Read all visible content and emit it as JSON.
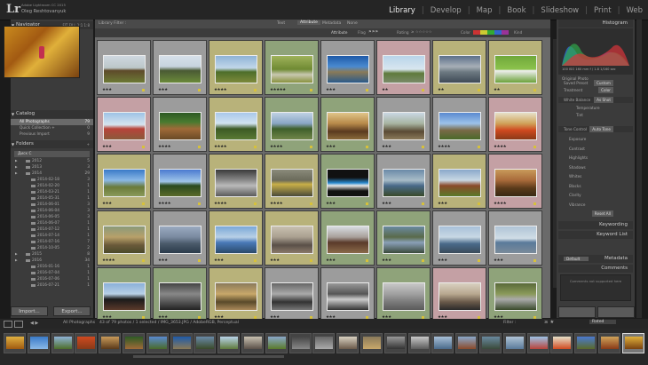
{
  "app": {
    "logo": "Lr",
    "version": "Adobe Lightroom CC 2015",
    "user": "Oleg Reshtovanyuk"
  },
  "modules": [
    "Library",
    "Develop",
    "Map",
    "Book",
    "Slideshow",
    "Print",
    "Web"
  ],
  "active_module": "Library",
  "left_panel": {
    "navigator": {
      "title": "Navigator",
      "options": "FIT  FILL  1:1  1:8"
    },
    "catalog": {
      "title": "Catalog",
      "items": [
        {
          "label": "All Photographs",
          "count": "79"
        },
        {
          "label": "Quick Collection +",
          "count": "0"
        },
        {
          "label": "Previous Import",
          "count": "9"
        }
      ]
    },
    "folders": {
      "title": "Folders",
      "drive": "Диск C"
    },
    "years": [
      {
        "label": "2012",
        "count": "5"
      },
      {
        "label": "2013",
        "count": "3"
      },
      {
        "label": "2014",
        "count": "29"
      }
    ],
    "months_2014": [
      {
        "label": "2014-02-18",
        "count": "3"
      },
      {
        "label": "2014-02-20",
        "count": "1"
      },
      {
        "label": "2014-03-21",
        "count": "1"
      },
      {
        "label": "2014-05-31",
        "count": "1"
      },
      {
        "label": "2014-06-01",
        "count": "3"
      },
      {
        "label": "2014-06-04",
        "count": "3"
      },
      {
        "label": "2014-06-05",
        "count": "3"
      },
      {
        "label": "2014-06-07",
        "count": "1"
      },
      {
        "label": "2014-07-12",
        "count": "1"
      },
      {
        "label": "2014-07-14",
        "count": "1"
      },
      {
        "label": "2014-07-16",
        "count": "7"
      },
      {
        "label": "2014-10-05",
        "count": "2"
      }
    ],
    "years_after": [
      {
        "label": "2015",
        "count": "8"
      },
      {
        "label": "2016",
        "count": "34"
      }
    ],
    "months_2016": [
      {
        "label": "2016-01-16",
        "count": "1"
      },
      {
        "label": "2016-07-04",
        "count": "1"
      },
      {
        "label": "2016-07-06",
        "count": "1"
      },
      {
        "label": "2016-07-21",
        "count": "1"
      }
    ],
    "import_label": "Import...",
    "export_label": "Export..."
  },
  "filter_bar": {
    "title": "Library Filter :",
    "tabs": [
      "Text",
      "Attribute",
      "Metadata",
      "None"
    ],
    "active": "Attribute"
  },
  "toolbar": {
    "attribute": "Attribute",
    "flag": "Flag",
    "rating": "Rating",
    "color": "Color",
    "kind": "Kind"
  },
  "grid": {
    "cells": [
      {
        "rating": "★★★",
        "bg": "#9c9c9c",
        "img": "linear-gradient(#cfd8e0 0%,#bcc7c9 45%,#5e4a2a 55%,#6c7a35 100%)"
      },
      {
        "rating": "★★★",
        "bg": "#9c9c9c",
        "img": "linear-gradient(#d6e0ea 0%,#c7d3de 40%,#4a5a34 55%,#6b8a3a 100%)"
      },
      {
        "rating": "★★★★",
        "bg": "#b8b27a",
        "img": "linear-gradient(#8fb3d6 0%,#c1d7ea 45%,#4d6e2a 60%,#7d8a3b 100%)"
      },
      {
        "rating": "★★★★★",
        "bg": "#8fa37a",
        "img": "linear-gradient(#9fb25a 0%,#6f8a33 50%,#c8c8b0 70%,#88923e 100%)"
      },
      {
        "rating": "★★★",
        "bg": "#9c9c9c",
        "img": "linear-gradient(#1e5aa8 0%,#4a8ad0 40%,#8a7a58 60%,#2a5a8a 100%)"
      },
      {
        "rating": "★★",
        "bg": "#c4a0a4",
        "img": "linear-gradient(#b9d4ea 0%,#d8e6ef 50%,#5f7a3c 65%,#7a8a68 100%)"
      },
      {
        "rating": "★★",
        "bg": "#b8b27a",
        "img": "linear-gradient(#5b6f8a 0%,#a7afb7 40%,#6d7a82 60%,#3f4a56 100%)"
      },
      {
        "rating": "★★",
        "bg": "#b8b27a",
        "img": "linear-gradient(#6fa83a 0%,#8cc24c 50%,#f0f0f0 55%,#6ba23a 100%)"
      },
      {
        "rating": "★★★",
        "bg": "#c4a0a4",
        "img": "linear-gradient(#9ec3e6 0%,#d6e4ef 45%,#b8433a 60%,#8a5a3a 100%)"
      },
      {
        "rating": "★★★★",
        "bg": "#9c9c9c",
        "img": "linear-gradient(#2d5a24 0%,#4a7a30 35%,#a06a38 60%,#6a4a26 100%)"
      },
      {
        "rating": "★★★★",
        "bg": "#b8b27a",
        "img": "linear-gradient(#a9c8ea 0%,#d2e3f0 40%,#3c5a24 60%,#5a7a34 100%)"
      },
      {
        "rating": "★★★★",
        "bg": "#8fa37a",
        "img": "linear-gradient(#bfd1e4 0%,#8aa6c4 40%,#3e5f2a 60%,#71874a 100%)"
      },
      {
        "rating": "★★★",
        "bg": "#8fa37a",
        "img": "linear-gradient(#e0c58a 0%,#b88a4a 40%,#5a3a20 70%,#8a6a3a 100%)"
      },
      {
        "rating": "★★★",
        "bg": "#9c9c9c",
        "img": "linear-gradient(#c9d7e4 0%,#a8b5a2 40%,#5a4a34 70%,#8a7a5a 100%)"
      },
      {
        "rating": "★★★★",
        "bg": "#9c9c9c",
        "img": "linear-gradient(#5a8ad0 0%,#9cc2ea 40%,#7a6a48 65%,#4a6a2a 100%)"
      },
      {
        "rating": "★★★★",
        "bg": "#c4a0a4",
        "img": "linear-gradient(#e6e0c8 0%,#d0a35a 40%,#d04a20 65%,#8a3a18 100%)"
      },
      {
        "rating": "★★★",
        "bg": "#b8b27a",
        "img": "linear-gradient(#3a7ac8 0%,#8ab8e6 40%,#6a7a3a 65%,#8a9a5a 100%)"
      },
      {
        "rating": "★★★★",
        "bg": "#9c9c9c",
        "img": "linear-gradient(#4a7ad0 0%,#a0c6ea 45%,#2a4a1e 60%,#5a6a2a 100%)"
      },
      {
        "rating": "★★★★",
        "bg": "#b8b27a",
        "img": "linear-gradient(#3a3a3a 0%,#8a8a8a 40%,#bababa 60%,#5a5a5a 100%)"
      },
      {
        "rating": "★★★★",
        "bg": "#b8b27a",
        "img": "linear-gradient(#8a8a7a 0%,#6a6a5a 40%,#c9b048 55%,#4a4a3a 100%)"
      },
      {
        "rating": "★★★",
        "bg": "#8fa37a",
        "img": "linear-gradient(#111 0%,#111 30%,#2a8ad0 50%,#e8e8e8 60%,#111 80%)"
      },
      {
        "rating": "★★★",
        "bg": "#9c9c9c",
        "img": "linear-gradient(#6a8aa8 0%,#a8bcc8 40%,#4a6a8a 60%,#3a4a2a 100%)"
      },
      {
        "rating": "★★★",
        "bg": "#b8b27a",
        "img": "linear-gradient(#8aa8ca 0%,#c8d8e4 40%,#8a4a2a 60%,#5a7a2a 100%)"
      },
      {
        "rating": "★★★★",
        "bg": "#c4a0a4",
        "img": "linear-gradient(#c89a5a 0%,#a86a3a 40%,#5a3a1a 70%,#3a2a14 100%)"
      },
      {
        "rating": "★★★★",
        "bg": "#b8b27a",
        "img": "linear-gradient(#8a9a7a 0%,#b8a06a 40%,#6a5a3a 70%,#4a4a2a 100%)"
      },
      {
        "rating": "★★★",
        "bg": "#9c9c9c",
        "img": "linear-gradient(#9aaac0 0%,#7a8aa0 40%,#4a5a6a 65%,#2a3a4a 100%)"
      },
      {
        "rating": "★★★",
        "bg": "#b8b27a",
        "img": "linear-gradient(#7aa8d8 0%,#b8d0e6 40%,#4a7ab8 60%,#2a4a6a 100%)"
      },
      {
        "rating": "★★★",
        "bg": "#b8b27a",
        "img": "linear-gradient(#c8c0b0 0%,#aaa090 40%,#5a5048 70%,#8a7a6a 100%)"
      },
      {
        "rating": "★★★",
        "bg": "#8fa37a",
        "img": "linear-gradient(#d8dde2 0%,#a8a09a 40%,#5a3a2a 60%,#8a6a4a 100%)"
      },
      {
        "rating": "★★★",
        "bg": "#8fa37a",
        "img": "linear-gradient(#6a8aa0 0%,#5a6a4a 40%,#8aa0b8 60%,#3a4a3a 100%)"
      },
      {
        "rating": "★★★",
        "bg": "#9c9c9c",
        "img": "linear-gradient(#a8c0d8 0%,#c8d8e4 40%,#4a6a8a 65%,#3a4a5a 100%)"
      },
      {
        "rating": "★★★",
        "bg": "#9c9c9c",
        "img": "linear-gradient(#b0c4d6 0%,#d0dde6 45%,#5a7a9a 60%,#7a8a9a 100%)"
      },
      {
        "rating": "★★★",
        "bg": "#8fa37a",
        "img": "linear-gradient(#8ab0d8 0%,#b8d0e6 40%,#1a1a1a 60%,#5a3a2a 100%)"
      },
      {
        "rating": "★★★",
        "bg": "#8fa37a",
        "img": "linear-gradient(#444 0%,#888 40%,#555 70%,#222 100%)"
      },
      {
        "rating": "★★★",
        "bg": "#b8b27a",
        "img": "linear-gradient(#8a7a5a 0%,#c8a86a 40%,#5a4a2a 70%,#aa8a5a 100%)"
      },
      {
        "rating": "★★★",
        "bg": "#9c9c9c",
        "img": "linear-gradient(#666 0%,#aaa 40%,#333 70%,#777 100%)"
      },
      {
        "rating": "★★★",
        "bg": "#9c9c9c",
        "img": "linear-gradient(#999 0%,#555 40%,#ccc 60%,#333 100%)"
      },
      {
        "rating": "★★★",
        "bg": "#8fa37a",
        "img": "linear-gradient(#c8c8c8 0%,#a0a0a0 40%,#7a7a7a 70%,#5a5a5a 100%)"
      },
      {
        "rating": "★★★",
        "bg": "#c4a0a4",
        "img": "linear-gradient(#d8d0c0 0%,#b8a890 40%,#6a5a4a 70%,#2a2a2a 100%)"
      },
      {
        "rating": "★★★",
        "bg": "#8fa37a",
        "img": "linear-gradient(#5a6a3a 0%,#8a9a5a 40%,#aaaaaa 60%,#3a4a2a 100%)"
      }
    ]
  },
  "right_panel": {
    "histogram": {
      "title": "Histogram",
      "readout": "100 ISO   160 mm   f / 1.8   1/160 sec"
    },
    "original_photo_label": "Original Photo",
    "quick_develop": [
      {
        "key": "Saved Preset",
        "value": "Custom"
      },
      {
        "key": "Treatment",
        "value": "Color"
      }
    ],
    "white_balance": {
      "key": "White Balance",
      "value": "As Shot"
    },
    "wb_controls": [
      "Temperature",
      "Tint"
    ],
    "tone_control": {
      "key": "Tone Control",
      "value": "Auto Tone"
    },
    "tone_rows": [
      "Exposure",
      "Contrast",
      "Highlights",
      "Shadows",
      "Whites",
      "Blacks",
      "Clarity",
      "Vibrance"
    ],
    "reset_all": "Reset All",
    "keywording_title": "Keywording",
    "keyword_list_title": "Keyword List",
    "metadata_preset": "Default",
    "metadata_title": "Metadata",
    "comments_title": "Comments",
    "comments_note": "Comments not supported here"
  },
  "status_bar": {
    "source": "All Photographs",
    "info": "43 of 79 photos / 1 selected / IMG_3653.JPG / AdobeRGB, Perceptual",
    "filter": "Filter :",
    "filter_value": "Rated"
  },
  "filmstrip": {
    "thumbs": [
      "linear-gradient(#e0b040,#a05a10)",
      "linear-gradient(#3a7ac8,#8ab8e6)",
      "linear-gradient(#8fb3d6,#4d6e2a)",
      "linear-gradient(#d04a20,#8a3a18)",
      "linear-gradient(#c89a5a,#5a3a1a)",
      "linear-gradient(#2d5a24,#a06a38)",
      "linear-gradient(#5a8ad0,#4a6a2a)",
      "linear-gradient(#1e5aa8,#8a7a58)",
      "linear-gradient(#6a8aa8,#3a4a2a)",
      "linear-gradient(#b9d4ea,#5f7a3c)",
      "linear-gradient(#c8c0b0,#5a5048)",
      "linear-gradient(#8aa8ca,#5a7a2a)",
      "linear-gradient(#444,#888)",
      "linear-gradient(#666,#aaa)",
      "linear-gradient(#d8d0c0,#6a5a4a)",
      "linear-gradient(#8a7a5a,#c8a86a)",
      "linear-gradient(#999,#333)",
      "linear-gradient(#c8c8c8,#5a5a5a)",
      "linear-gradient(#a8c0d8,#4a6a8a)",
      "linear-gradient(#8aa8ca,#8a4a2a)",
      "linear-gradient(#6a8aa0,#3a4a3a)",
      "linear-gradient(#b0c4d6,#5a7a9a)",
      "linear-gradient(#9ec3e6,#b8433a)",
      "linear-gradient(#e6e0c8,#d04a20)",
      "linear-gradient(#4a7ad0,#5a6a2a)",
      "linear-gradient(#d0a35a,#8a3a18)",
      "linear-gradient(#e0b03a,#7a4210)"
    ]
  }
}
